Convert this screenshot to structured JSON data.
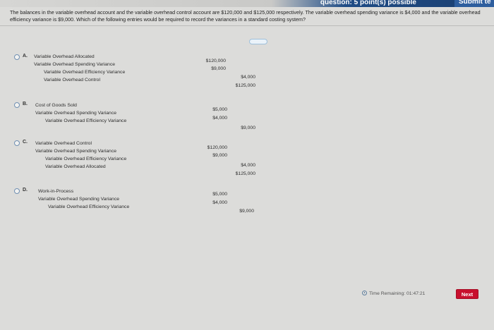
{
  "header": {
    "points_text": "question: 5 point(s) possible",
    "submit_label": "Submit te"
  },
  "question": {
    "text": "The balances in the variable overhead account and the variable overhead control account are $120,000 and $125,000 respectively. The variable overhead spending variance is $4,000 and the variable overhead efficiency variance is $9,000. Which of the following entries would be required to record the variances in a standard costing system?"
  },
  "options": [
    {
      "letter": "A.",
      "lines": [
        {
          "account": "Variable Overhead Allocated",
          "debit": "$120,000",
          "credit": ""
        },
        {
          "account": "Variable Overhead Spending Variance",
          "debit": "$9,000",
          "credit": ""
        },
        {
          "account": "Variable Overhead Efficiency Variance",
          "debit": "",
          "credit": "$4,000"
        },
        {
          "account": "Variable Overhead Control",
          "debit": "",
          "credit": "$125,000"
        }
      ]
    },
    {
      "letter": "B.",
      "lines": [
        {
          "account": "Cost of Goods Sold",
          "debit": "$5,000",
          "credit": ""
        },
        {
          "account": "Variable Overhead Spending Variance",
          "debit": "$4,000",
          "credit": ""
        },
        {
          "account": "Variable Overhead Efficiency Variance",
          "debit": "",
          "credit": "$9,000"
        }
      ]
    },
    {
      "letter": "C.",
      "lines": [
        {
          "account": "Variable Overhead Control",
          "debit": "$120,000",
          "credit": ""
        },
        {
          "account": "Variable Overhead Spending Variance",
          "debit": "$9,000",
          "credit": ""
        },
        {
          "account": "Variable Overhead Efficiency Variance",
          "debit": "",
          "credit": "$4,000"
        },
        {
          "account": "Variable Overhead Allocated",
          "debit": "",
          "credit": "$125,000"
        }
      ]
    },
    {
      "letter": "D.",
      "lines": [
        {
          "account": "Work-in-Process",
          "debit": "$5,000",
          "credit": ""
        },
        {
          "account": "Variable Overhead Spending Variance",
          "debit": "$4,000",
          "credit": ""
        },
        {
          "account": "Variable Overhead Efficiency Variance",
          "debit": "",
          "credit": "$9,000"
        }
      ]
    }
  ],
  "footer": {
    "timer_text": "Time Remaining: 01:47:21",
    "next_label": "Next"
  }
}
